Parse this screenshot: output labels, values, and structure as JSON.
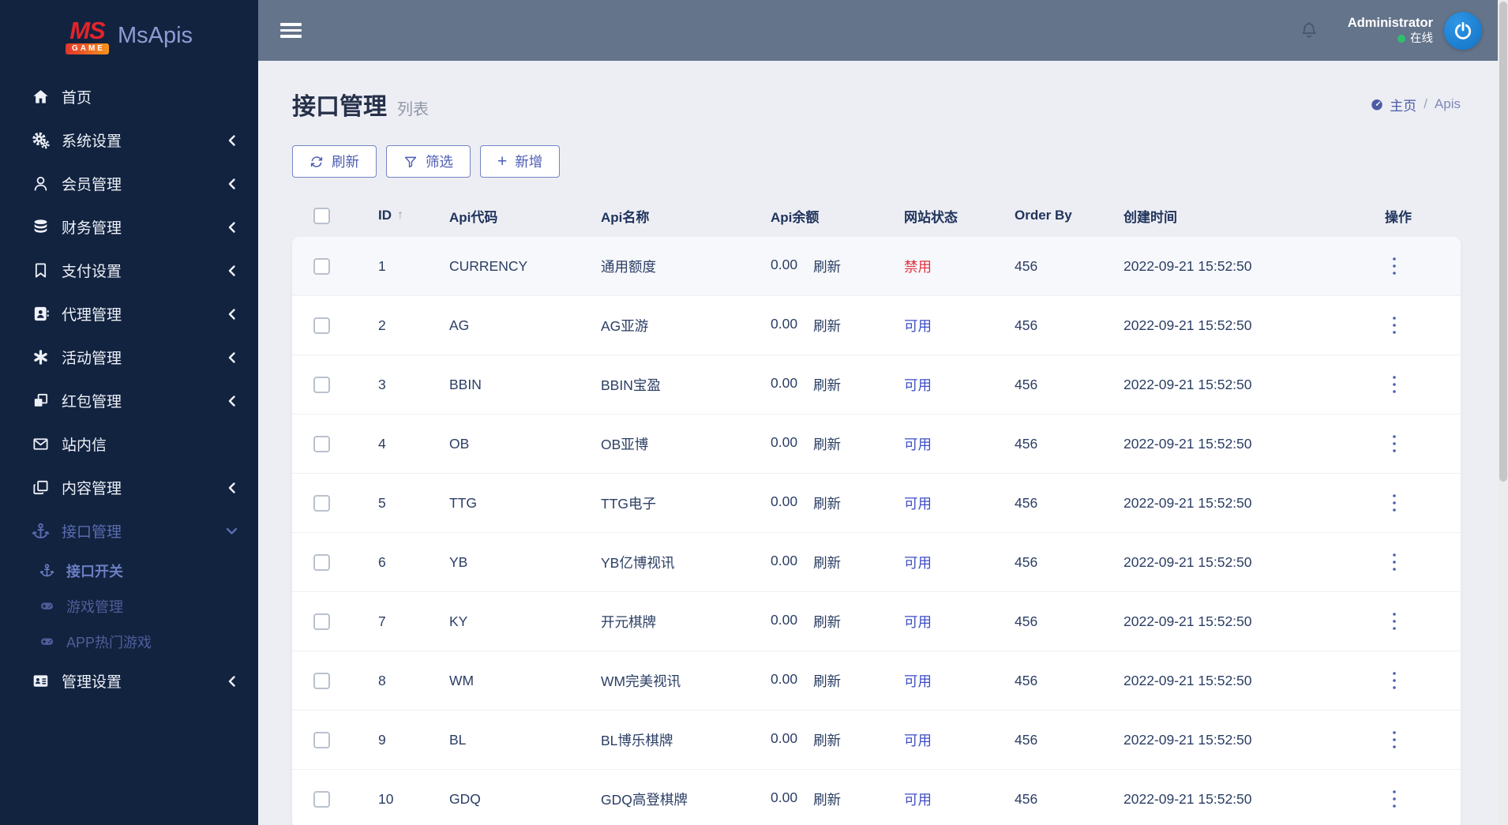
{
  "brand": {
    "logo_ms": "MS",
    "logo_game": "GAME",
    "app_name": "MsApis"
  },
  "topbar": {
    "user_name": "Administrator",
    "user_status": "在线",
    "online_color": "#2ec06f"
  },
  "sidebar": {
    "items": [
      {
        "key": "home",
        "label": "首页",
        "icon": "home-icon"
      },
      {
        "key": "system-settings",
        "label": "系统设置",
        "icon": "gears-icon",
        "chevron": "left"
      },
      {
        "key": "member-management",
        "label": "会员管理",
        "icon": "user-icon",
        "chevron": "left"
      },
      {
        "key": "finance-management",
        "label": "财务管理",
        "icon": "database-icon",
        "chevron": "left"
      },
      {
        "key": "payment-settings",
        "label": "支付设置",
        "icon": "bookmark-icon",
        "chevron": "left"
      },
      {
        "key": "agent-management",
        "label": "代理管理",
        "icon": "address-book-icon",
        "chevron": "left"
      },
      {
        "key": "activity-management",
        "label": "活动管理",
        "icon": "asterisk-icon",
        "chevron": "left"
      },
      {
        "key": "red-packet-management",
        "label": "红包管理",
        "icon": "red-packet-icon",
        "chevron": "left"
      },
      {
        "key": "site-messages",
        "label": "站内信",
        "icon": "envelope-icon"
      },
      {
        "key": "content-management",
        "label": "内容管理",
        "icon": "copy-icon",
        "chevron": "left"
      },
      {
        "key": "api-management",
        "label": "接口管理",
        "icon": "anchor-icon",
        "chevron": "down",
        "active": true
      },
      {
        "key": "api-switch",
        "label": "接口开关",
        "icon": "anchor-icon",
        "sub": true,
        "current": true
      },
      {
        "key": "game-management",
        "label": "游戏管理",
        "icon": "gamepad-icon",
        "sub": true
      },
      {
        "key": "app-hot-games",
        "label": "APP热门游戏",
        "icon": "gamepad-icon",
        "sub": true
      },
      {
        "key": "admin-settings",
        "label": "管理设置",
        "icon": "id-card-icon",
        "chevron": "left"
      }
    ]
  },
  "page": {
    "title": "接口管理",
    "subtitle": "列表",
    "breadcrumb": {
      "home": "主页",
      "separator": "/",
      "current": "Apis"
    }
  },
  "toolbar": {
    "refresh_label": "刷新",
    "filter_label": "筛选",
    "add_label": "新增"
  },
  "table": {
    "headers": {
      "id": "ID",
      "code": "Api代码",
      "name": "Api名称",
      "balance": "Api余额",
      "status": "网站状态",
      "order": "Order By",
      "created": "创建时间",
      "actions": "操作"
    },
    "sort_arrow": "↑",
    "refresh_label": "刷新",
    "status_colors": {
      "disabled": "#e03444",
      "enabled": "#3e4ec5"
    },
    "rows": [
      {
        "id": "1",
        "code": "CURRENCY",
        "name": "通用额度",
        "balance": "0.00",
        "status": "禁用",
        "status_type": "disabled",
        "order": "456",
        "created": "2022-09-21 15:52:50"
      },
      {
        "id": "2",
        "code": "AG",
        "name": "AG亚游",
        "balance": "0.00",
        "status": "可用",
        "status_type": "enabled",
        "order": "456",
        "created": "2022-09-21 15:52:50"
      },
      {
        "id": "3",
        "code": "BBIN",
        "name": "BBIN宝盈",
        "balance": "0.00",
        "status": "可用",
        "status_type": "enabled",
        "order": "456",
        "created": "2022-09-21 15:52:50"
      },
      {
        "id": "4",
        "code": "OB",
        "name": "OB亚博",
        "balance": "0.00",
        "status": "可用",
        "status_type": "enabled",
        "order": "456",
        "created": "2022-09-21 15:52:50"
      },
      {
        "id": "5",
        "code": "TTG",
        "name": "TTG电子",
        "balance": "0.00",
        "status": "可用",
        "status_type": "enabled",
        "order": "456",
        "created": "2022-09-21 15:52:50"
      },
      {
        "id": "6",
        "code": "YB",
        "name": "YB亿博视讯",
        "balance": "0.00",
        "status": "可用",
        "status_type": "enabled",
        "order": "456",
        "created": "2022-09-21 15:52:50"
      },
      {
        "id": "7",
        "code": "KY",
        "name": "开元棋牌",
        "balance": "0.00",
        "status": "可用",
        "status_type": "enabled",
        "order": "456",
        "created": "2022-09-21 15:52:50"
      },
      {
        "id": "8",
        "code": "WM",
        "name": "WM完美视讯",
        "balance": "0.00",
        "status": "可用",
        "status_type": "enabled",
        "order": "456",
        "created": "2022-09-21 15:52:50"
      },
      {
        "id": "9",
        "code": "BL",
        "name": "BL博乐棋牌",
        "balance": "0.00",
        "status": "可用",
        "status_type": "enabled",
        "order": "456",
        "created": "2022-09-21 15:52:50"
      },
      {
        "id": "10",
        "code": "GDQ",
        "name": "GDQ高登棋牌",
        "balance": "0.00",
        "status": "可用",
        "status_type": "enabled",
        "order": "456",
        "created": "2022-09-21 15:52:50"
      }
    ]
  }
}
